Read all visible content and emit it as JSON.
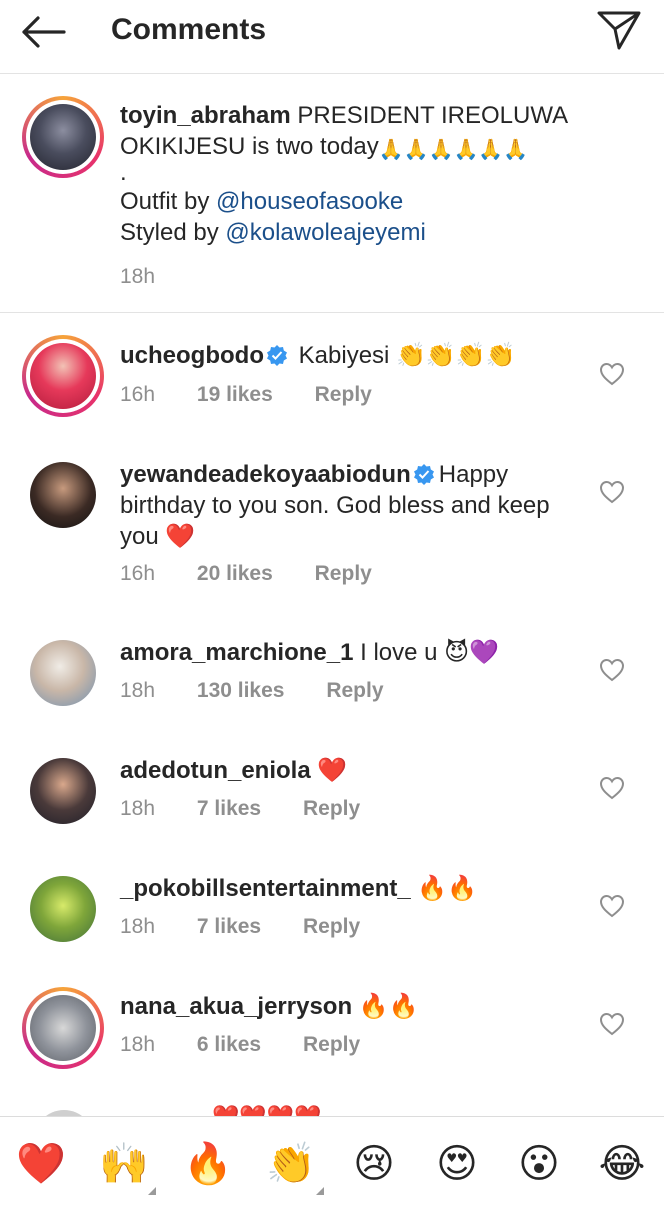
{
  "header": {
    "title": "Comments"
  },
  "caption": {
    "username": "toyin_abraham",
    "text_line1": "PRESIDENT IREOLUWA",
    "text_line2": "OKIKIJESU is two today",
    "emojis": "🙏🙏🙏🙏🙏🙏",
    "dot": ".",
    "outfit_prefix": "Outfit by ",
    "outfit_mention": "@houseofasooke",
    "styled_prefix": "Styled by ",
    "styled_mention": "@kolawoleajeyemi",
    "time": "18h"
  },
  "comments": [
    {
      "username": "ucheogbodo",
      "verified": true,
      "text": "Kabiyesi 👏👏👏👏",
      "time": "16h",
      "likes": "19 likes",
      "reply": "Reply"
    },
    {
      "username": "yewandeadekoyaabiodun",
      "verified": true,
      "text_line1": "Happy",
      "text_line2": "birthday to you son. God bless and keep",
      "text_line3": "you ❤️",
      "time": "16h",
      "likes": "20 likes",
      "reply": "Reply"
    },
    {
      "username": "amora_marchione_1",
      "text": "I love u 😈💜",
      "time": "18h",
      "likes": "130 likes",
      "reply": "Reply"
    },
    {
      "username": "adedotun_eniola",
      "text": "❤️",
      "time": "18h",
      "likes": "7 likes",
      "reply": "Reply"
    },
    {
      "username": "_pokobillsentertainment_",
      "text": "🔥🔥",
      "time": "18h",
      "likes": "7 likes",
      "reply": "Reply"
    },
    {
      "username": "nana_akua_jerryson",
      "text": "🔥🔥",
      "time": "18h",
      "likes": "6 likes",
      "reply": "Reply"
    }
  ],
  "peek": {
    "text": "❤️❤️❤️❤️"
  },
  "emoji_bar": [
    "❤️",
    "🙌",
    "🔥",
    "👏",
    "😢",
    "😍",
    "😮",
    "😂"
  ]
}
